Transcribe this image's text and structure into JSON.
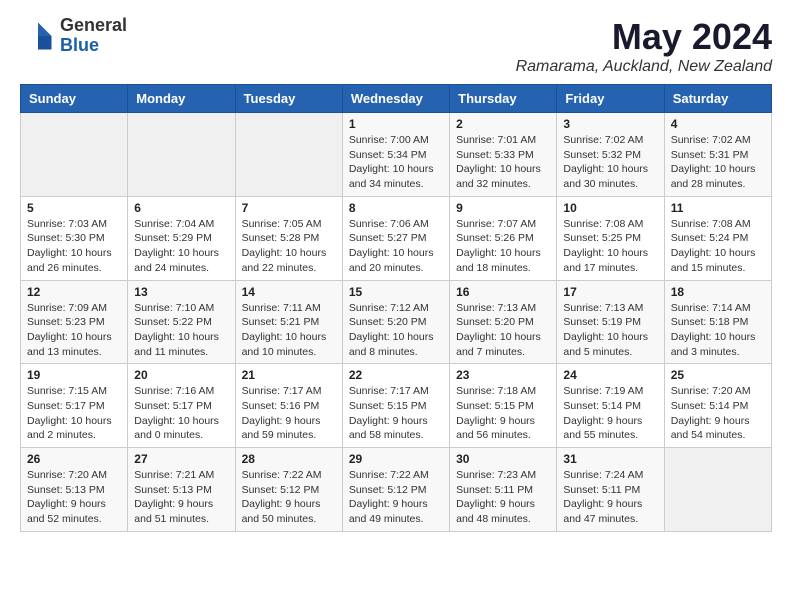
{
  "header": {
    "logo_general": "General",
    "logo_blue": "Blue",
    "month": "May 2024",
    "location": "Ramarama, Auckland, New Zealand"
  },
  "weekdays": [
    "Sunday",
    "Monday",
    "Tuesday",
    "Wednesday",
    "Thursday",
    "Friday",
    "Saturday"
  ],
  "weeks": [
    [
      {
        "day": "",
        "info": ""
      },
      {
        "day": "",
        "info": ""
      },
      {
        "day": "",
        "info": ""
      },
      {
        "day": "1",
        "info": "Sunrise: 7:00 AM\nSunset: 5:34 PM\nDaylight: 10 hours\nand 34 minutes."
      },
      {
        "day": "2",
        "info": "Sunrise: 7:01 AM\nSunset: 5:33 PM\nDaylight: 10 hours\nand 32 minutes."
      },
      {
        "day": "3",
        "info": "Sunrise: 7:02 AM\nSunset: 5:32 PM\nDaylight: 10 hours\nand 30 minutes."
      },
      {
        "day": "4",
        "info": "Sunrise: 7:02 AM\nSunset: 5:31 PM\nDaylight: 10 hours\nand 28 minutes."
      }
    ],
    [
      {
        "day": "5",
        "info": "Sunrise: 7:03 AM\nSunset: 5:30 PM\nDaylight: 10 hours\nand 26 minutes."
      },
      {
        "day": "6",
        "info": "Sunrise: 7:04 AM\nSunset: 5:29 PM\nDaylight: 10 hours\nand 24 minutes."
      },
      {
        "day": "7",
        "info": "Sunrise: 7:05 AM\nSunset: 5:28 PM\nDaylight: 10 hours\nand 22 minutes."
      },
      {
        "day": "8",
        "info": "Sunrise: 7:06 AM\nSunset: 5:27 PM\nDaylight: 10 hours\nand 20 minutes."
      },
      {
        "day": "9",
        "info": "Sunrise: 7:07 AM\nSunset: 5:26 PM\nDaylight: 10 hours\nand 18 minutes."
      },
      {
        "day": "10",
        "info": "Sunrise: 7:08 AM\nSunset: 5:25 PM\nDaylight: 10 hours\nand 17 minutes."
      },
      {
        "day": "11",
        "info": "Sunrise: 7:08 AM\nSunset: 5:24 PM\nDaylight: 10 hours\nand 15 minutes."
      }
    ],
    [
      {
        "day": "12",
        "info": "Sunrise: 7:09 AM\nSunset: 5:23 PM\nDaylight: 10 hours\nand 13 minutes."
      },
      {
        "day": "13",
        "info": "Sunrise: 7:10 AM\nSunset: 5:22 PM\nDaylight: 10 hours\nand 11 minutes."
      },
      {
        "day": "14",
        "info": "Sunrise: 7:11 AM\nSunset: 5:21 PM\nDaylight: 10 hours\nand 10 minutes."
      },
      {
        "day": "15",
        "info": "Sunrise: 7:12 AM\nSunset: 5:20 PM\nDaylight: 10 hours\nand 8 minutes."
      },
      {
        "day": "16",
        "info": "Sunrise: 7:13 AM\nSunset: 5:20 PM\nDaylight: 10 hours\nand 7 minutes."
      },
      {
        "day": "17",
        "info": "Sunrise: 7:13 AM\nSunset: 5:19 PM\nDaylight: 10 hours\nand 5 minutes."
      },
      {
        "day": "18",
        "info": "Sunrise: 7:14 AM\nSunset: 5:18 PM\nDaylight: 10 hours\nand 3 minutes."
      }
    ],
    [
      {
        "day": "19",
        "info": "Sunrise: 7:15 AM\nSunset: 5:17 PM\nDaylight: 10 hours\nand 2 minutes."
      },
      {
        "day": "20",
        "info": "Sunrise: 7:16 AM\nSunset: 5:17 PM\nDaylight: 10 hours\nand 0 minutes."
      },
      {
        "day": "21",
        "info": "Sunrise: 7:17 AM\nSunset: 5:16 PM\nDaylight: 9 hours\nand 59 minutes."
      },
      {
        "day": "22",
        "info": "Sunrise: 7:17 AM\nSunset: 5:15 PM\nDaylight: 9 hours\nand 58 minutes."
      },
      {
        "day": "23",
        "info": "Sunrise: 7:18 AM\nSunset: 5:15 PM\nDaylight: 9 hours\nand 56 minutes."
      },
      {
        "day": "24",
        "info": "Sunrise: 7:19 AM\nSunset: 5:14 PM\nDaylight: 9 hours\nand 55 minutes."
      },
      {
        "day": "25",
        "info": "Sunrise: 7:20 AM\nSunset: 5:14 PM\nDaylight: 9 hours\nand 54 minutes."
      }
    ],
    [
      {
        "day": "26",
        "info": "Sunrise: 7:20 AM\nSunset: 5:13 PM\nDaylight: 9 hours\nand 52 minutes."
      },
      {
        "day": "27",
        "info": "Sunrise: 7:21 AM\nSunset: 5:13 PM\nDaylight: 9 hours\nand 51 minutes."
      },
      {
        "day": "28",
        "info": "Sunrise: 7:22 AM\nSunset: 5:12 PM\nDaylight: 9 hours\nand 50 minutes."
      },
      {
        "day": "29",
        "info": "Sunrise: 7:22 AM\nSunset: 5:12 PM\nDaylight: 9 hours\nand 49 minutes."
      },
      {
        "day": "30",
        "info": "Sunrise: 7:23 AM\nSunset: 5:11 PM\nDaylight: 9 hours\nand 48 minutes."
      },
      {
        "day": "31",
        "info": "Sunrise: 7:24 AM\nSunset: 5:11 PM\nDaylight: 9 hours\nand 47 minutes."
      },
      {
        "day": "",
        "info": ""
      }
    ]
  ]
}
